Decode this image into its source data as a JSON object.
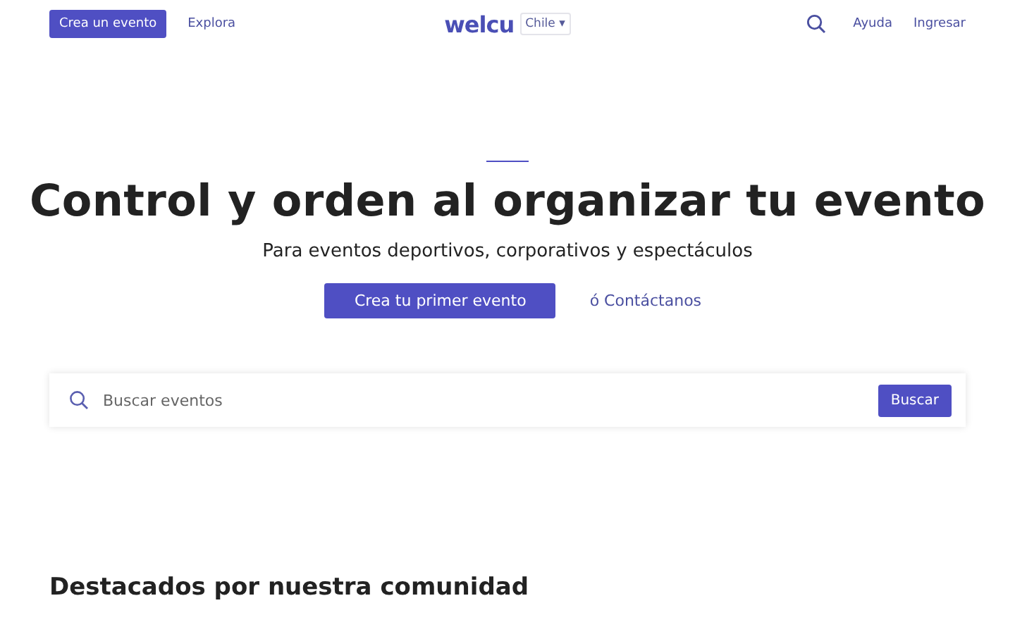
{
  "header": {
    "create_button": "Crea un evento",
    "explore_link": "Explora",
    "logo": "welcu",
    "country": "Chile ▾",
    "help_link": "Ayuda",
    "login_link": "Ingresar"
  },
  "hero": {
    "title": "Control y orden al organizar tu evento",
    "subtitle": "Para eventos deportivos, corporativos y espectáculos",
    "cta_button": "Crea tu primer evento",
    "contact_link": "ó Contáctanos"
  },
  "search": {
    "placeholder": "Buscar eventos",
    "button": "Buscar"
  },
  "featured": {
    "title": "Destacados por nuestra comunidad"
  }
}
